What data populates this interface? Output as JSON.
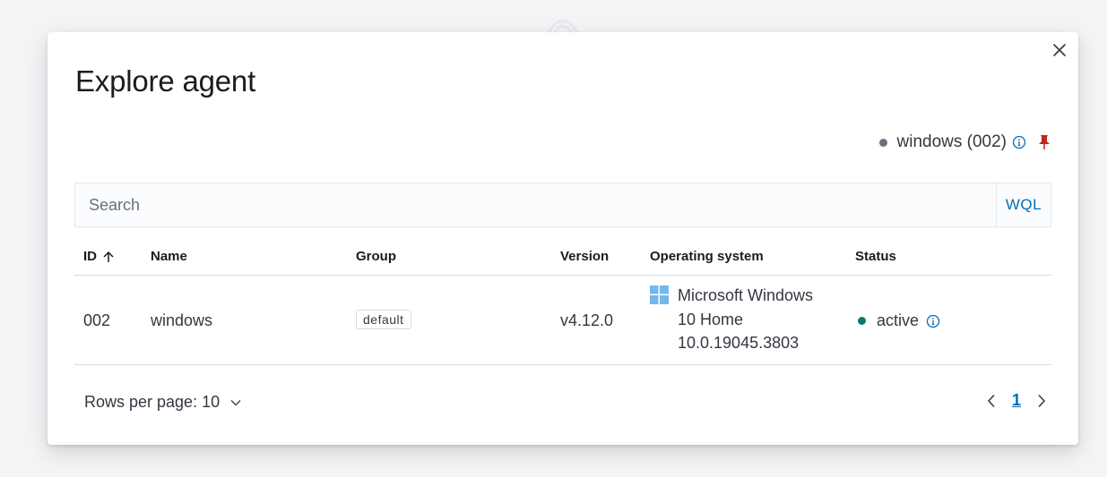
{
  "modal": {
    "title": "Explore agent",
    "pinned_agent": {
      "label": "windows (002)",
      "dot_color": "#69707d",
      "info_icon": "info-icon",
      "pin_icon": "pin-icon",
      "pin_color": "#bd271e"
    }
  },
  "search": {
    "placeholder": "Search",
    "wql_label": "WQL"
  },
  "table": {
    "columns": [
      "ID",
      "Name",
      "Group",
      "Version",
      "Operating system",
      "Status"
    ],
    "sort_column": "ID",
    "rows": [
      {
        "id": "002",
        "name": "windows",
        "group": "default",
        "version": "v4.12.0",
        "os_line1": "Microsoft Windows",
        "os_line2": "10 Home",
        "os_line3": "10.0.19045.3803",
        "os_icon": "windows-icon",
        "status": "active",
        "status_color": "#017d73"
      }
    ]
  },
  "pagination": {
    "rows_per_page_label": "Rows per page: 10",
    "current_page": "1"
  },
  "colors": {
    "accent": "#006bb8",
    "windows_blue": "#72b8ec"
  }
}
